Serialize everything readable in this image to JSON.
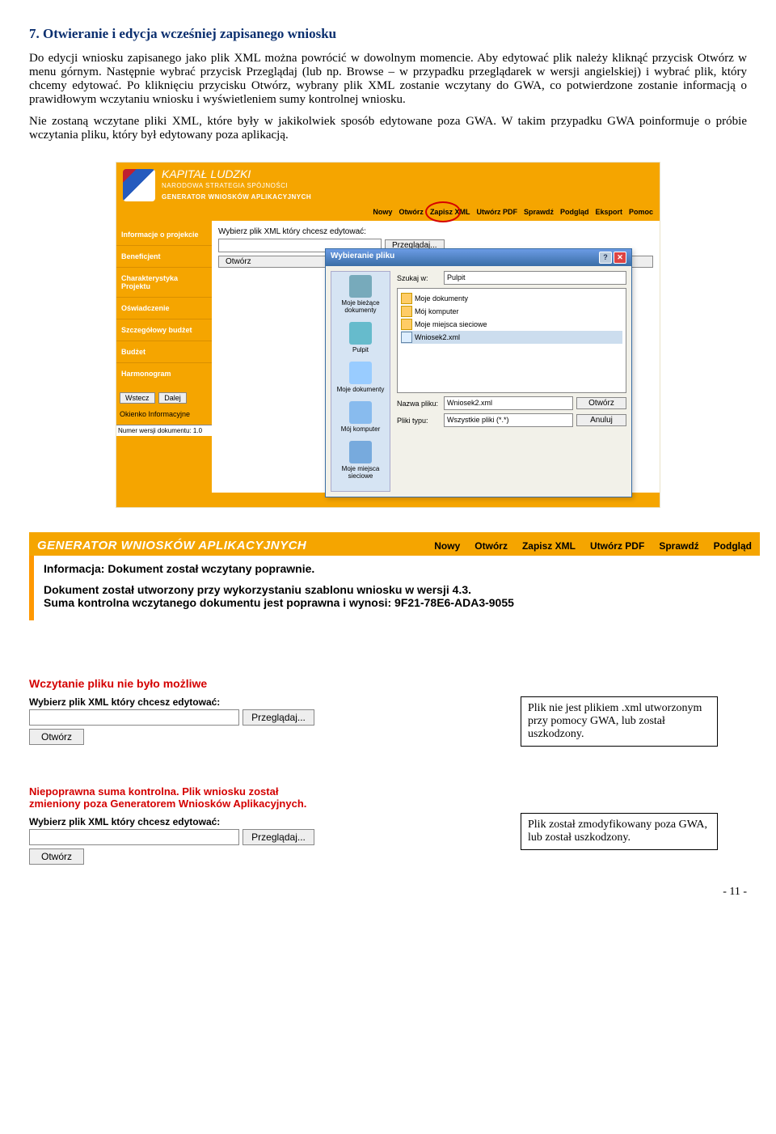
{
  "section": {
    "title": "7.   Otwieranie i edycja wcześniej zapisanego wniosku",
    "p1": "Do edycji wniosku zapisanego jako plik XML można powrócić w dowolnym momencie. Aby edytować plik należy kliknąć przycisk Otwórz w menu górnym. Następnie wybrać przycisk Przeglądaj (lub np. Browse – w przypadku przeglądarek w wersji angielskiej) i wybrać plik, który chcemy edytować. Po kliknięciu przycisku Otwórz, wybrany plik XML zostanie wczytany do GWA, co potwierdzone zostanie informacją o prawidłowym wczytaniu wniosku i wyświetleniem sumy kontrolnej wniosku.",
    "p2": "Nie zostaną wczytane pliki XML, które były w jakikolwiek sposób edytowane poza GWA. W takim przypadku GWA poinformuje o próbie wczytania pliku, który był edytowany poza aplikacją."
  },
  "app": {
    "title_main": "KAPITAŁ LUDZKI",
    "title_sub": "NARODOWA STRATEGIA SPÓJNOŚCI",
    "title_gen": "GENERATOR WNIOSKÓW APLIKACYJNYCH",
    "toolbar": {
      "nowy": "Nowy",
      "otworz": "Otwórz",
      "zapisz": "Zapisz XML",
      "pdf": "Utwórz PDF",
      "sprawdz": "Sprawdź",
      "podglad": "Podgląd",
      "eksport": "Eksport",
      "pomoc": "Pomoc"
    },
    "sidebar": {
      "items": [
        "Informacje o projekcie",
        "Beneficjent",
        "Charakterystyka Projektu",
        "Oświadczenie",
        "Szczegółowy budżet",
        "Budżet",
        "Harmonogram"
      ],
      "wstecz": "Wstecz",
      "dalej": "Dalej",
      "okienko": "Okienko Informacyjne",
      "ver": "Numer wersji dokumentu: 1.0"
    },
    "main": {
      "prompt": "Wybierz plik XML który chcesz edytować:",
      "browse": "Przeglądaj...",
      "open": "Otwórz"
    },
    "dialog": {
      "title": "Wybieranie pliku",
      "lookin_lbl": "Szukaj w:",
      "lookin_val": "Pulpit",
      "places": [
        "Moje bieżące dokumenty",
        "Pulpit",
        "Moje dokumenty",
        "Mój komputer",
        "Moje miejsca sieciowe"
      ],
      "files": [
        "Moje dokumenty",
        "Mój komputer",
        "Moje miejsca sieciowe",
        "Wniosek2.xml"
      ],
      "fname_lbl": "Nazwa pliku:",
      "fname_val": "Wniosek2.xml",
      "ftype_lbl": "Pliki typu:",
      "ftype_val": "Wszystkie pliki (*.*)",
      "btn_open": "Otwórz",
      "btn_cancel": "Anuluj"
    }
  },
  "banner2": {
    "title": "GENERATOR WNIOSKÓW APLIKACYJNYCH",
    "links": {
      "nowy": "Nowy",
      "otworz": "Otwórz",
      "zapisz": "Zapisz XML",
      "pdf": "Utwórz PDF",
      "sprawdz": "Sprawdź",
      "podglad": "Podgląd"
    }
  },
  "info_panel": {
    "l1": "Informacja: Dokument został wczytany poprawnie.",
    "l2": "Dokument został utworzony przy wykorzystaniu szablonu wniosku w wersji 4.3.",
    "l3": "Suma kontrolna wczytanego dokumentu jest poprawna i wynosi: 9F21-78E6-ADA3-9055"
  },
  "err_block1": {
    "msg": "Wczytanie pliku nie było możliwe",
    "prompt": "Wybierz plik XML który chcesz edytować:",
    "browse": "Przeglądaj...",
    "open": "Otwórz"
  },
  "callout1": "Plik nie jest plikiem .xml utworzonym przy pomocy GWA, lub został uszkodzony.",
  "err_block2": {
    "msg": "Niepoprawna suma kontrolna. Plik wniosku został zmieniony poza Generatorem Wniosków Aplikacyjnych.",
    "prompt": "Wybierz plik XML który chcesz edytować:",
    "browse": "Przeglądaj...",
    "open": "Otwórz"
  },
  "callout2": "Plik został zmodyfikowany poza GWA, lub został uszkodzony.",
  "page_num": "- 11 -"
}
